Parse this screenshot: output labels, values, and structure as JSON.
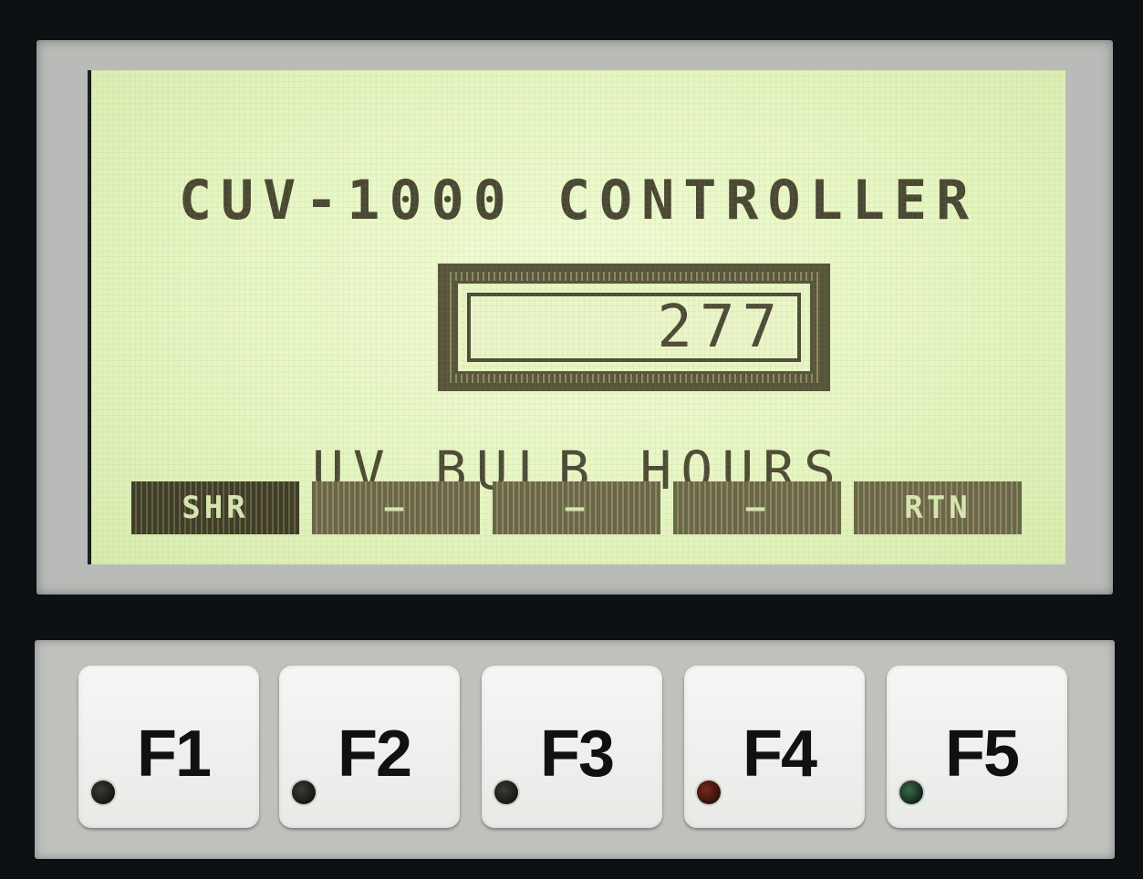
{
  "display": {
    "title": "CUV-1000 CONTROLLER",
    "counter_value": "277",
    "label": "UV BULB HOURS",
    "softkeys": [
      {
        "label": "SHR",
        "active": true
      },
      {
        "label": "—",
        "active": false
      },
      {
        "label": "—",
        "active": false
      },
      {
        "label": "—",
        "active": false
      },
      {
        "label": "RTN",
        "active": false
      }
    ]
  },
  "keys": [
    {
      "label": "F1",
      "led": "off"
    },
    {
      "label": "F2",
      "led": "off"
    },
    {
      "label": "F3",
      "led": "off"
    },
    {
      "label": "F4",
      "led": "red"
    },
    {
      "label": "F5",
      "led": "green"
    }
  ],
  "colors": {
    "lcd_background": "#e6f6c2",
    "lcd_pixels": "#4d4a35",
    "panel": "#b9bbb8"
  }
}
